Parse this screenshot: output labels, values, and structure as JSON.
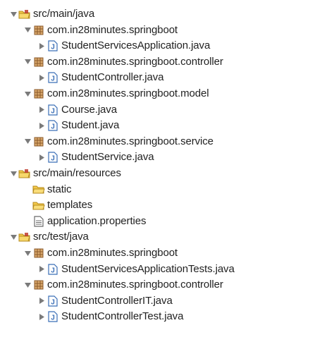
{
  "tree": {
    "nodes": [
      {
        "label": "src/main/java",
        "icon": "source-folder-icon",
        "expander": "expanded",
        "depth": 0
      },
      {
        "label": "com.in28minutes.springboot",
        "icon": "package-icon",
        "expander": "expanded",
        "depth": 1
      },
      {
        "label": "StudentServicesApplication.java",
        "icon": "java-file-icon",
        "expander": "collapsed",
        "depth": 2
      },
      {
        "label": "com.in28minutes.springboot.controller",
        "icon": "package-icon",
        "expander": "expanded",
        "depth": 1
      },
      {
        "label": "StudentController.java",
        "icon": "java-file-icon",
        "expander": "collapsed",
        "depth": 2
      },
      {
        "label": "com.in28minutes.springboot.model",
        "icon": "package-icon",
        "expander": "expanded",
        "depth": 1
      },
      {
        "label": "Course.java",
        "icon": "java-file-icon",
        "expander": "collapsed",
        "depth": 2
      },
      {
        "label": "Student.java",
        "icon": "java-file-icon",
        "expander": "collapsed",
        "depth": 2
      },
      {
        "label": "com.in28minutes.springboot.service",
        "icon": "package-icon",
        "expander": "expanded",
        "depth": 1
      },
      {
        "label": "StudentService.java",
        "icon": "java-file-icon",
        "expander": "collapsed",
        "depth": 2
      },
      {
        "label": "src/main/resources",
        "icon": "source-folder-icon",
        "expander": "expanded",
        "depth": 0
      },
      {
        "label": "static",
        "icon": "folder-icon",
        "expander": "none",
        "depth": 1
      },
      {
        "label": "templates",
        "icon": "folder-icon",
        "expander": "none",
        "depth": 1
      },
      {
        "label": "application.properties",
        "icon": "properties-file-icon",
        "expander": "none",
        "depth": 1
      },
      {
        "label": "src/test/java",
        "icon": "source-folder-icon",
        "expander": "expanded",
        "depth": 0
      },
      {
        "label": "com.in28minutes.springboot",
        "icon": "package-icon",
        "expander": "expanded",
        "depth": 1
      },
      {
        "label": "StudentServicesApplicationTests.java",
        "icon": "java-file-icon",
        "expander": "collapsed",
        "depth": 2
      },
      {
        "label": "com.in28minutes.springboot.controller",
        "icon": "package-icon",
        "expander": "expanded",
        "depth": 1
      },
      {
        "label": "StudentControllerIT.java",
        "icon": "java-file-icon",
        "expander": "collapsed",
        "depth": 2
      },
      {
        "label": "StudentControllerTest.java",
        "icon": "java-file-icon",
        "expander": "collapsed",
        "depth": 2
      }
    ]
  },
  "colors": {
    "text": "#222222",
    "twistie": "#7a7a7a",
    "folder": "#e5b83a",
    "package": "#9b6b3c",
    "java": "#3b6fb6"
  }
}
